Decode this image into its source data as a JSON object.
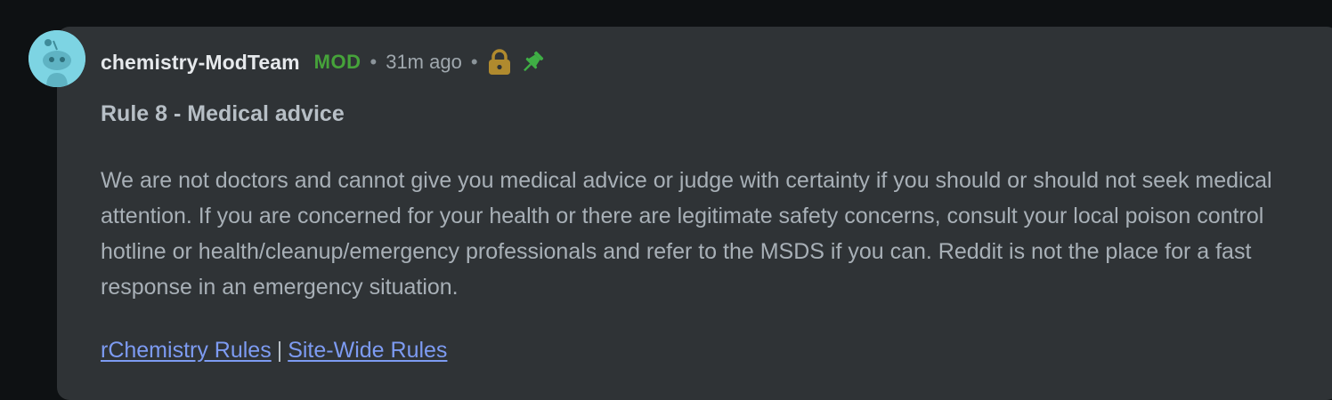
{
  "comment": {
    "author": "chemistry-ModTeam",
    "badge": "MOD",
    "separator": "•",
    "timestamp": "31m ago",
    "icons": [
      "lock-icon",
      "pin-icon"
    ],
    "title": "Rule 8 - Medical advice",
    "body": "We are not doctors and cannot give you medical advice or judge with certainty if you should or should not seek medical attention. If you are concerned for your health or there are legitimate safety concerns, consult your local poison control hotline or health/cleanup/emergency professionals and refer to the MSDS if you can. Reddit is not the place for a fast response in an emergency situation.",
    "links": [
      {
        "label": "rChemistry Rules"
      },
      {
        "label": "Site-Wide Rules"
      }
    ],
    "link_separator": "|"
  },
  "colors": {
    "background": "#0e1113",
    "card": "#2f3336",
    "mod_badge": "#46a33a",
    "lock": "#b08a2e",
    "pin": "#3fae45",
    "link": "#7d9bf2",
    "avatar": "#7dd4e3"
  }
}
